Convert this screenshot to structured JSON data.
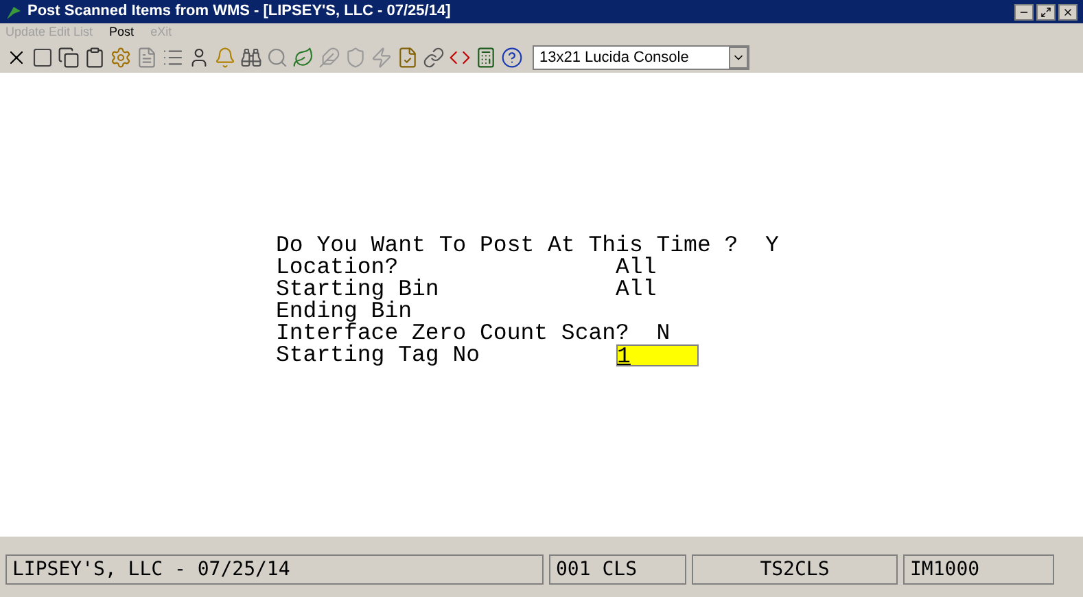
{
  "window": {
    "title": "Post Scanned Items from WMS - [LIPSEY'S, LLC - 07/25/14]"
  },
  "menu": [
    {
      "label": "Update Edit List",
      "disabled": true
    },
    {
      "label": "Post",
      "disabled": false
    },
    {
      "label": "eXit",
      "disabled": true
    }
  ],
  "toolbar": {
    "font_select": "13x21 Lucida Console"
  },
  "form": [
    {
      "label": "Do You Want To Post At This Time ?",
      "kind": "text",
      "value": "Y"
    },
    {
      "label": "Location?",
      "kind": "text",
      "value": "All"
    },
    {
      "label": "Starting Bin",
      "kind": "text",
      "value": "All"
    },
    {
      "label": "Ending Bin",
      "kind": "text"
    },
    {
      "label": "Interface Zero Count Scan?",
      "kind": "text",
      "value": "N"
    },
    {
      "label": "Starting Tag No",
      "kind": "input",
      "value": "1"
    }
  ],
  "status_bar": [
    "LIPSEY'S, LLC - 07/25/14",
    "001 CLS",
    "TS2CLS",
    "IM1000"
  ]
}
